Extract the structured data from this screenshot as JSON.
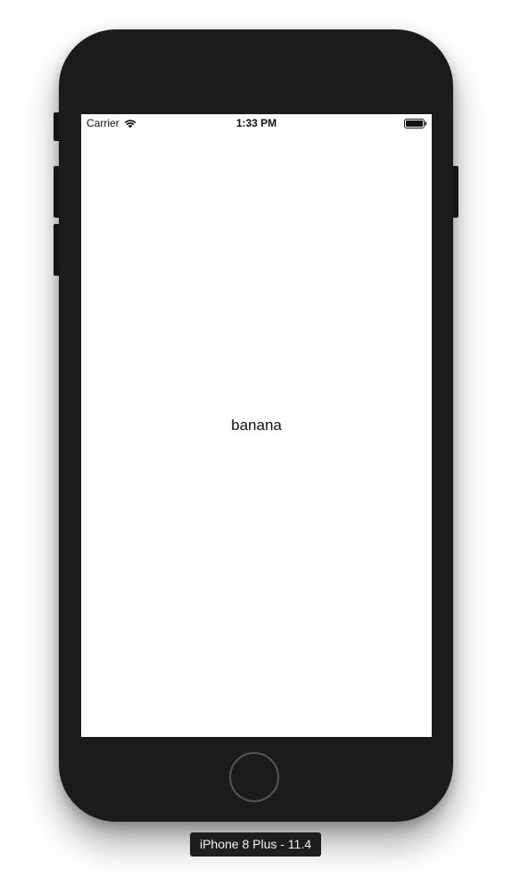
{
  "status_bar": {
    "carrier": "Carrier",
    "time": "1:33 PM",
    "wifi_icon": "wifi-icon",
    "battery_icon": "battery-full-icon"
  },
  "screen": {
    "label": "banana"
  },
  "simulator": {
    "device_label": "iPhone 8 Plus - 11.4"
  },
  "colors": {
    "bezel": "#1b1b1b",
    "screen_bg": "#ffffff",
    "home_ring": "#555555"
  }
}
